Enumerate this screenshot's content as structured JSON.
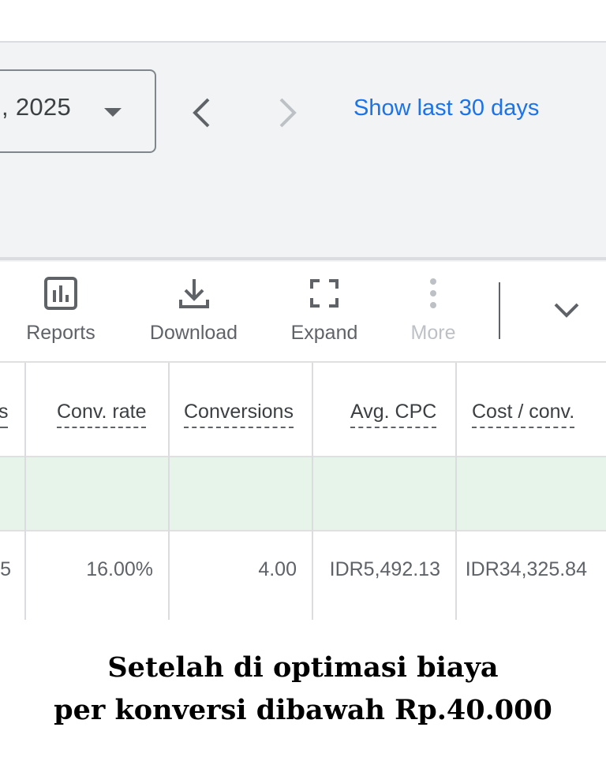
{
  "date_range": {
    "value": ", 2025"
  },
  "nav": {
    "show_last_label": "Show last 30 days"
  },
  "toolbar": {
    "reports_label": "Reports",
    "download_label": "Download",
    "expand_label": "Expand",
    "more_label": "More"
  },
  "table": {
    "partial_header": "s",
    "partial_value": "5",
    "headers": [
      "Conv. rate",
      "Conversions",
      "Avg. CPC",
      "Cost / conv."
    ],
    "row": [
      "16.00%",
      "4.00",
      "IDR5,492.13",
      "IDR34,325.84"
    ]
  },
  "caption": {
    "line1": "Setelah di optimasi biaya",
    "line2": "per konversi dibawah Rp.40.000"
  },
  "colors": {
    "link": "#1a73e8",
    "summary_row": "#e6f4ea",
    "band": "#f1f3f4"
  }
}
